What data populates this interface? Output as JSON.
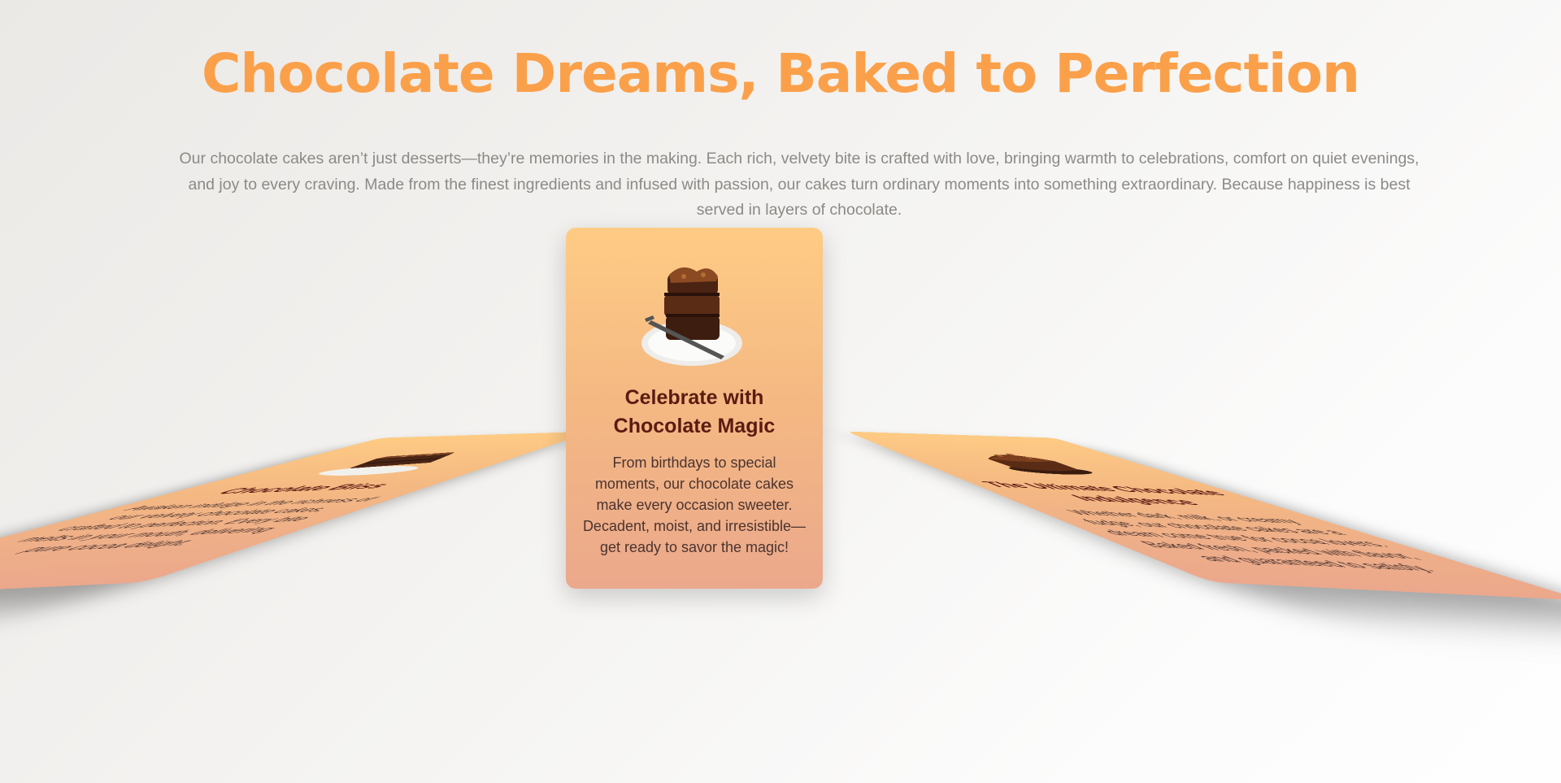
{
  "header": {
    "title": "Chocolate Dreams, Baked to Perfection",
    "intro": "Our chocolate cakes aren’t just desserts—they’re memories in the making. Each rich, velvety bite is crafted with love, bringing warmth to celebrations, comfort on quiet evenings, and joy to every craving. Made from the finest ingredients and infused with passion, our cakes turn ordinary moments into something extraordinary. Because happiness is best served in layers of chocolate."
  },
  "cards": [
    {
      "title": "Chocolate Bliss",
      "text": "Awaken indulge in the richness of our velvety chocolate cakes, crafted to perfection. Every bite melts in your mouth, delivering pure cocoa delight."
    },
    {
      "title": "Celebrate with Chocolate Magic",
      "text": "From birthdays to special moments, our chocolate cakes make every occasion sweeter. Decadent, moist, and irresistible—get ready to savor the magic!"
    },
    {
      "title": "The Ultimate Chocolate Indulgence",
      "text": "Whether dark, milk, or creamy fudge, our chocolate cakes are a dream come true for cocoa lovers. Baked fresh, packed with flavor, and guaranteed to satisfy."
    }
  ],
  "colors": {
    "title": "#fba04a",
    "card_top": "#fecb84",
    "card_bottom": "#eba88c",
    "card_title": "#5a1b12"
  },
  "icons": {
    "card_image": "chocolate-cake-slice"
  }
}
